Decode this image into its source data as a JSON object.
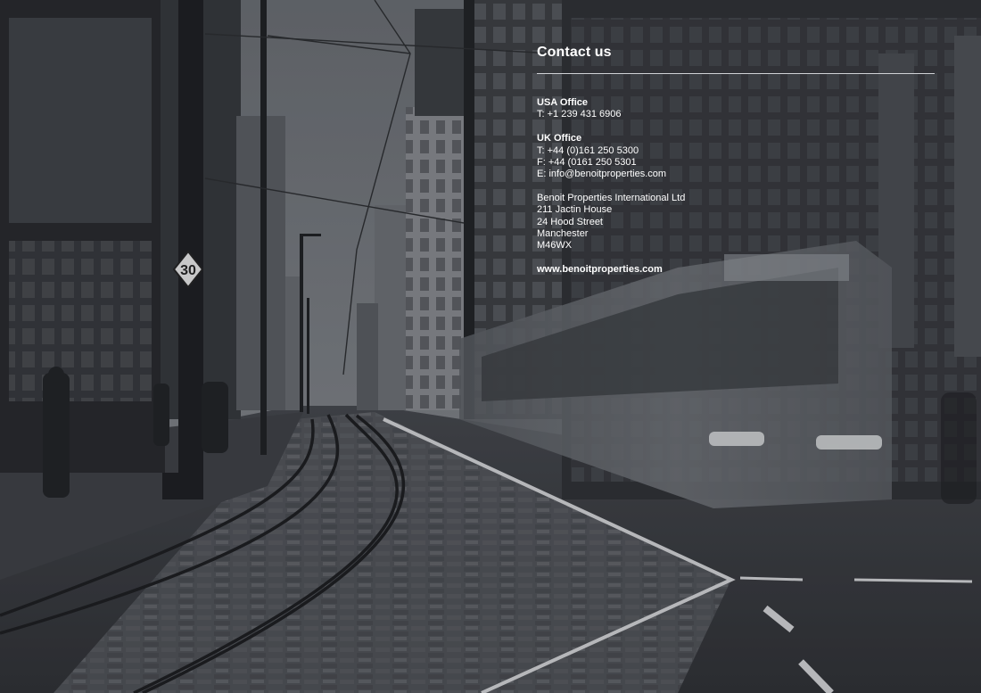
{
  "contact": {
    "title": "Contact us",
    "usa": {
      "heading": "USA Office",
      "phone": "T: +1 239 431 6906"
    },
    "uk": {
      "heading": "UK Office",
      "phone": "T: +44 (0)161 250 5300",
      "fax": "F: +44 (0161 250 5301",
      "email": "E: info@benoitproperties.com"
    },
    "company": {
      "name": "Benoit Properties International Ltd",
      "address": [
        "211 Jactin House",
        "24 Hood Street",
        "Manchester",
        "M46WX"
      ]
    },
    "website": "www.benoitproperties.com"
  },
  "photo": {
    "speed_sign": "30",
    "palette": {
      "sky": "#777b80",
      "street": "#4a4d52",
      "shadow": "#1d1f22",
      "tram": "#6f7377"
    }
  }
}
